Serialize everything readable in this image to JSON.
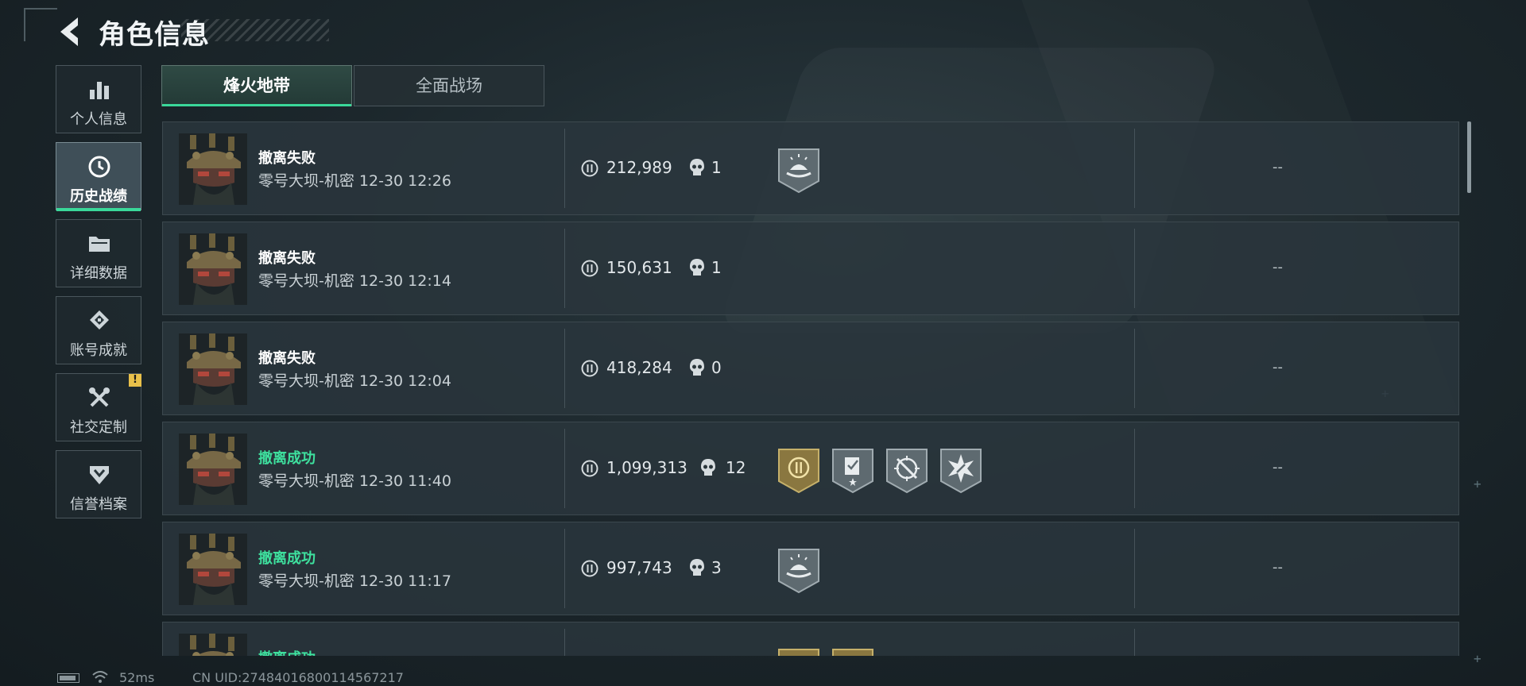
{
  "header": {
    "title": "角色信息",
    "back_icon": "chevron-left-icon"
  },
  "sidebar": {
    "items": [
      {
        "label": "个人信息",
        "icon": "bar-chart-icon",
        "active": false
      },
      {
        "label": "历史战绩",
        "icon": "history-clock-icon",
        "active": true
      },
      {
        "label": "详细数据",
        "icon": "folder-icon",
        "active": false
      },
      {
        "label": "账号成就",
        "icon": "achievement-icon",
        "active": false
      },
      {
        "label": "社交定制",
        "icon": "tools-icon",
        "active": false,
        "badge": "!"
      },
      {
        "label": "信誉档案",
        "icon": "shield-chevron-icon",
        "active": false
      }
    ]
  },
  "tabs": [
    {
      "label": "烽火地带",
      "active": true
    },
    {
      "label": "全面战场",
      "active": false
    }
  ],
  "matches": [
    {
      "result": "撤离失败",
      "status": "fail",
      "map": "零号大坝-机密",
      "time": "12-30 12:26",
      "value": "212,989",
      "kills": "1",
      "badges": [
        "sunrise-badge-icon"
      ],
      "extra": "--"
    },
    {
      "result": "撤离失败",
      "status": "fail",
      "map": "零号大坝-机密",
      "time": "12-30 12:14",
      "value": "150,631",
      "kills": "1",
      "badges": [],
      "extra": "--"
    },
    {
      "result": "撤离失败",
      "status": "fail",
      "map": "零号大坝-机密",
      "time": "12-30 12:04",
      "value": "418,284",
      "kills": "0",
      "badges": [],
      "extra": "--"
    },
    {
      "result": "撤离成功",
      "status": "success",
      "map": "零号大坝-机密",
      "time": "12-30 11:40",
      "value": "1,099,313",
      "kills": "12",
      "badges": [
        "gold-emblem-badge-icon",
        "document-star-badge-icon",
        "crosshair-badge-icon",
        "burst-badge-icon"
      ],
      "extra": "--"
    },
    {
      "result": "撤离成功",
      "status": "success",
      "map": "零号大坝-机密",
      "time": "12-30 11:17",
      "value": "997,743",
      "kills": "3",
      "badges": [
        "sunrise-badge-icon"
      ],
      "extra": "--"
    },
    {
      "result": "撤离成功",
      "status": "success",
      "map": "",
      "time": "",
      "value": "",
      "kills": "",
      "badges": [
        "gold-badge-icon",
        "gold-badge-icon"
      ],
      "extra": ""
    }
  ],
  "footer": {
    "ping": "52ms",
    "uid": "CN UID:27484016800114567217"
  },
  "colors": {
    "success": "#3ee09e",
    "accent": "#3ad89a",
    "background": "#1c272c",
    "gold_badge": "#8a7740",
    "alert_badge": "#e8c04a"
  }
}
